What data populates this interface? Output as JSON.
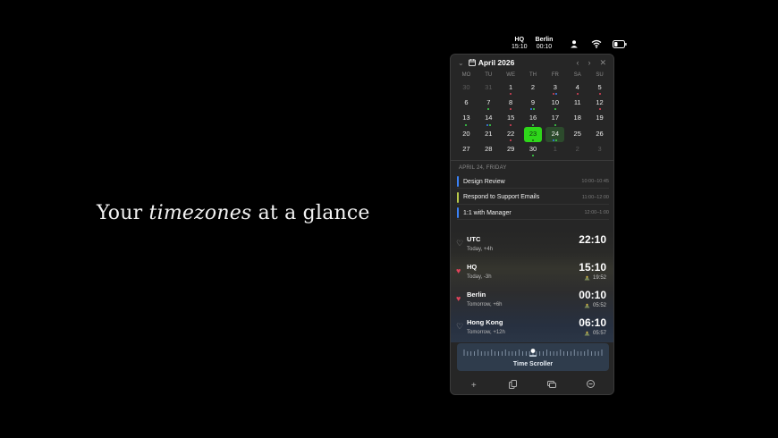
{
  "tagline": {
    "before": "Your ",
    "emph": "timezones",
    "after": " at a glance"
  },
  "menubar": {
    "zones": [
      {
        "name": "HQ",
        "time": "15:10"
      },
      {
        "name": "Berlin",
        "time": "00:10"
      }
    ],
    "icons": [
      "user-icon",
      "wifi-icon",
      "battery-icon"
    ]
  },
  "calendar": {
    "month_label": "April 2026",
    "weekdays": [
      "MO",
      "TU",
      "WE",
      "TH",
      "FR",
      "SA",
      "SU"
    ],
    "days": [
      {
        "n": "30",
        "muted": true,
        "dots": []
      },
      {
        "n": "31",
        "muted": true,
        "dots": []
      },
      {
        "n": "1",
        "dots": [
          "#e0435a"
        ]
      },
      {
        "n": "2",
        "dots": []
      },
      {
        "n": "3",
        "dots": [
          "#e0435a",
          "#3b82f6"
        ]
      },
      {
        "n": "4",
        "dots": [
          "#e0435a"
        ]
      },
      {
        "n": "5",
        "dots": [
          "#e0435a"
        ]
      },
      {
        "n": "6",
        "dots": []
      },
      {
        "n": "7",
        "dots": [
          "#3ddc4a"
        ]
      },
      {
        "n": "8",
        "dots": [
          "#e0435a"
        ]
      },
      {
        "n": "9",
        "dots": [
          "#3b82f6",
          "#3ddc4a"
        ]
      },
      {
        "n": "10",
        "dots": [
          "#3ddc4a"
        ]
      },
      {
        "n": "11",
        "dots": []
      },
      {
        "n": "12",
        "dots": [
          "#e0435a"
        ]
      },
      {
        "n": "13",
        "dots": [
          "#3ddc4a"
        ]
      },
      {
        "n": "14",
        "dots": [
          "#3b82f6",
          "#3ddc4a"
        ]
      },
      {
        "n": "15",
        "dots": [
          "#e0435a"
        ]
      },
      {
        "n": "16",
        "dots": [
          "#3ddc4a"
        ]
      },
      {
        "n": "17",
        "dots": [
          "#3ddc4a"
        ]
      },
      {
        "n": "18",
        "dots": []
      },
      {
        "n": "19",
        "dots": []
      },
      {
        "n": "20",
        "dots": []
      },
      {
        "n": "21",
        "dots": []
      },
      {
        "n": "22",
        "dots": [
          "#e0435a"
        ]
      },
      {
        "n": "23",
        "today": true,
        "dots": [
          "#3ddc4a"
        ]
      },
      {
        "n": "24",
        "selected": true,
        "dots": [
          "#3b82f6",
          "#3ddc4a"
        ]
      },
      {
        "n": "25",
        "dots": []
      },
      {
        "n": "26",
        "dots": []
      },
      {
        "n": "27",
        "dots": []
      },
      {
        "n": "28",
        "dots": []
      },
      {
        "n": "29",
        "dots": []
      },
      {
        "n": "30",
        "dots": [
          "#3ddc4a"
        ]
      },
      {
        "n": "1",
        "muted": true,
        "dots": []
      },
      {
        "n": "2",
        "muted": true,
        "dots": []
      },
      {
        "n": "3",
        "muted": true,
        "dots": []
      }
    ]
  },
  "agenda": {
    "date_label": "APRIL 24, FRIDAY",
    "events": [
      {
        "title": "Design Review",
        "time": "10:00–10:45",
        "color": "#3b82f6"
      },
      {
        "title": "Respond to Support Emails",
        "time": "11:00–12:00",
        "color": "#b8c94a"
      },
      {
        "title": "1:1 with Manager",
        "time": "12:00–1:00",
        "color": "#3b82f6"
      }
    ]
  },
  "zones": [
    {
      "name": "UTC",
      "offset": "Today, +4h",
      "time": "22:10",
      "favorite": false,
      "sun": ""
    },
    {
      "name": "HQ",
      "offset": "Today, -3h",
      "time": "15:10",
      "favorite": true,
      "sun": "19:52"
    },
    {
      "name": "Berlin",
      "offset": "Tomorrow, +6h",
      "time": "00:10",
      "favorite": true,
      "sun": "05:52"
    },
    {
      "name": "Hong Kong",
      "offset": "Tomorrow, +12h",
      "time": "06:10",
      "favorite": false,
      "sun": "05:57"
    }
  ],
  "scroller": {
    "label": "Time Scroller",
    "position": 0.5
  },
  "toolbar": {
    "icons": [
      "plus-icon",
      "copy-icon",
      "windows-icon",
      "more-icon"
    ]
  },
  "colors": {
    "accent_green": "#2ed61a",
    "favorite_red": "#e0435a",
    "panel_bg": "#262626"
  }
}
